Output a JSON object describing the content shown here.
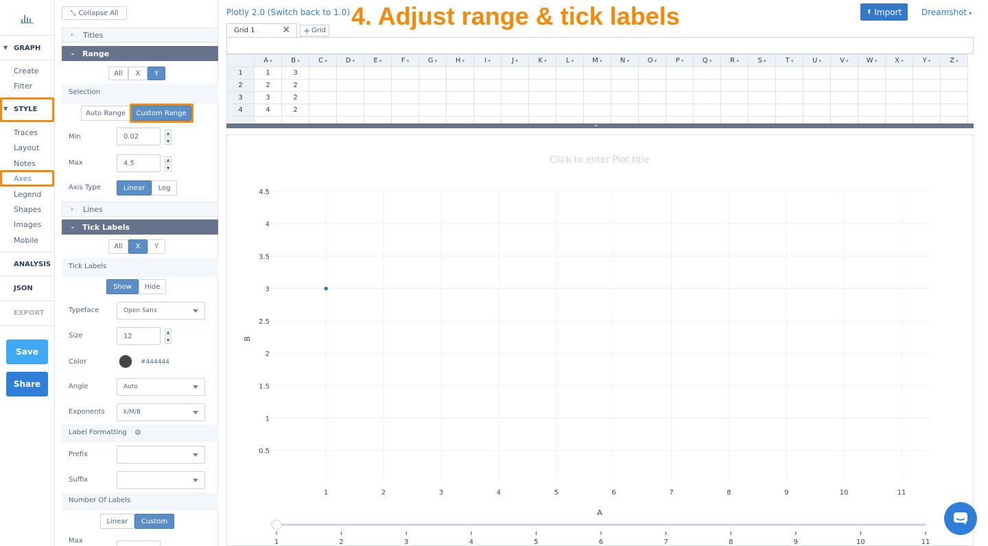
{
  "banner": "4. Adjust range & tick labels",
  "plotly_version": "Plotly 2.0 (Switch back to 1.0)",
  "import_label": "Import",
  "user_label": "Dreamshot",
  "grid_tab": "Grid 1",
  "add_grid_label": "Grid",
  "nav": {
    "graph": "GRAPH",
    "create": "Create",
    "filter": "Filter",
    "style": "STYLE",
    "traces": "Traces",
    "layout": "Layout",
    "notes": "Notes",
    "axes": "Axes",
    "legend": "Legend",
    "shapes": "Shapes",
    "images": "Images",
    "mobile": "Mobile",
    "analysis": "ANALYSIS",
    "json": "JSON",
    "export": "EXPORT",
    "save": "Save",
    "share": "Share"
  },
  "panel": {
    "collapse_all": "Collapse All",
    "titles": "Titles",
    "range": "Range",
    "axis_all": "All",
    "axis_x": "X",
    "axis_y": "Y",
    "selection": "Selection",
    "auto_range": "Auto Range",
    "custom_range": "Custom Range",
    "min_label": "Min",
    "min_value": "0.02",
    "max_label": "Max",
    "max_value": "4.5",
    "axis_type": "Axis Type",
    "linear": "Linear",
    "log": "Log",
    "lines": "Lines",
    "tick_labels": "Tick Labels",
    "tick_labels_field": "Tick Labels",
    "show": "Show",
    "hide": "Hide",
    "typeface": "Typeface",
    "typeface_value": "Open Sans",
    "size": "Size",
    "size_value": "12",
    "color": "Color",
    "color_value": "#444444",
    "angle": "Angle",
    "angle_value": "Auto",
    "exponents": "Exponents",
    "exponents_value": "k/M/B",
    "label_formatting": "Label Formatting",
    "prefix": "Prefix",
    "suffix": "Suffix",
    "number_of_labels": "Number Of Labels",
    "num_linear": "Linear",
    "num_custom": "Custom",
    "max2": "Max"
  },
  "grid": {
    "columns": [
      "A",
      "B",
      "C",
      "D",
      "E",
      "F",
      "G",
      "H",
      "I",
      "J",
      "K",
      "L",
      "M",
      "N",
      "O",
      "P",
      "Q",
      "R",
      "S",
      "T",
      "U",
      "V",
      "W",
      "X",
      "Y",
      "Z"
    ],
    "rows": [
      {
        "num": "1",
        "a": "1",
        "b": "3"
      },
      {
        "num": "2",
        "a": "2",
        "b": "2"
      },
      {
        "num": "3",
        "a": "3",
        "b": "2"
      },
      {
        "num": "4",
        "a": "4",
        "b": "2"
      }
    ]
  },
  "plot_title_placeholder": "Click to enter Plot title",
  "colors": {
    "accent": "#5b8ec6",
    "highlight": "#f4890b",
    "banner": "#f4890b",
    "dark_header": "#67738a",
    "save": "#3fa9f5",
    "share": "#2f7fd8"
  },
  "chart_data": {
    "type": "scatter",
    "xlabel": "A",
    "ylabel": "B",
    "x": [
      1
    ],
    "y": [
      3
    ],
    "xlim": [
      0.02,
      11.5
    ],
    "ylim": [
      0.02,
      4.5
    ],
    "xticks": [
      "1",
      "2",
      "3",
      "4",
      "5",
      "6",
      "7",
      "8",
      "9",
      "10",
      "11"
    ],
    "yticks": [
      "0.5",
      "1",
      "1.5",
      "2",
      "2.5",
      "3",
      "3.5",
      "4",
      "4.5"
    ],
    "slider_ticks": [
      "1",
      "2",
      "3",
      "4",
      "5",
      "6",
      "7",
      "8",
      "9",
      "10",
      "11"
    ],
    "grid": true
  }
}
